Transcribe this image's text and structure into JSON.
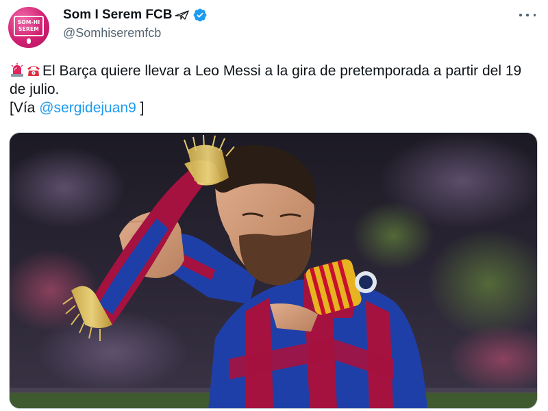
{
  "author": {
    "display_name": "Som I Serem FCB",
    "handle": "@Somhiseremfcb",
    "avatar_text": [
      "SOM-HI",
      "SEREM"
    ],
    "verified": true
  },
  "tweet": {
    "text_main": "El Barça quiere llevar a Leo Messi a la gira de pretemporada a partir del 19 de julio.",
    "via_prefix": "[Vía ",
    "via_mention": "@sergidejuan9",
    "via_suffix": " ]",
    "leading_emojis": [
      "police-light-emoji",
      "telephone-emoji"
    ]
  },
  "media": {
    "description_icon": "photo-messi-barcelona-captain-armband-scarf"
  },
  "colors": {
    "accent": "#1d9bf0",
    "avatar_pink": "#d21f72",
    "barca_blue": "#1f3fa8",
    "barca_red": "#a5123f"
  }
}
